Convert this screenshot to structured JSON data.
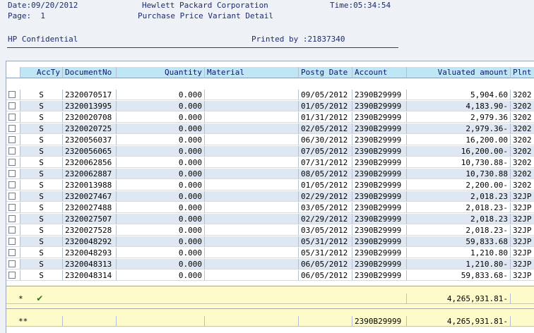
{
  "header": {
    "date": "Date:09/20/2012",
    "page": "Page:  1",
    "company": "Hewlett Packard Corporation",
    "time": "Time:05:34:54",
    "report_title": "Purchase Price Variant Detail",
    "confidential": "HP Confidential",
    "printed_by": "Printed by :21837340"
  },
  "columns": {
    "accty": "AccTy",
    "documentno": "DocumentNo",
    "quantity": "Quantity",
    "material": "Material",
    "postg_date": "Postg Date",
    "account": "Account",
    "valuated_amount": "Valuated amount",
    "plnt": "Plnt"
  },
  "rows": [
    {
      "accty": "S",
      "documentno": "2320070517",
      "quantity": "0.000",
      "material": "",
      "postg_date": "09/05/2012",
      "account": "2390B29999",
      "valuated_amount": "5,904.60",
      "plnt": "3202"
    },
    {
      "accty": "S",
      "documentno": "2320013995",
      "quantity": "0.000",
      "material": "",
      "postg_date": "01/05/2012",
      "account": "2390B29999",
      "valuated_amount": "4,183.90-",
      "plnt": "3202"
    },
    {
      "accty": "S",
      "documentno": "2320020708",
      "quantity": "0.000",
      "material": "",
      "postg_date": "01/31/2012",
      "account": "2390B29999",
      "valuated_amount": "2,979.36",
      "plnt": "3202"
    },
    {
      "accty": "S",
      "documentno": "2320020725",
      "quantity": "0.000",
      "material": "",
      "postg_date": "02/05/2012",
      "account": "2390B29999",
      "valuated_amount": "2,979.36-",
      "plnt": "3202"
    },
    {
      "accty": "S",
      "documentno": "2320056037",
      "quantity": "0.000",
      "material": "",
      "postg_date": "06/30/2012",
      "account": "2390B29999",
      "valuated_amount": "16,200.00",
      "plnt": "3202"
    },
    {
      "accty": "S",
      "documentno": "2320056065",
      "quantity": "0.000",
      "material": "",
      "postg_date": "07/05/2012",
      "account": "2390B29999",
      "valuated_amount": "16,200.00-",
      "plnt": "3202"
    },
    {
      "accty": "S",
      "documentno": "2320062856",
      "quantity": "0.000",
      "material": "",
      "postg_date": "07/31/2012",
      "account": "2390B29999",
      "valuated_amount": "10,730.88-",
      "plnt": "3202"
    },
    {
      "accty": "S",
      "documentno": "2320062887",
      "quantity": "0.000",
      "material": "",
      "postg_date": "08/05/2012",
      "account": "2390B29999",
      "valuated_amount": "10,730.88",
      "plnt": "3202"
    },
    {
      "accty": "S",
      "documentno": "2320013988",
      "quantity": "0.000",
      "material": "",
      "postg_date": "01/05/2012",
      "account": "2390B29999",
      "valuated_amount": "2,200.00-",
      "plnt": "3202"
    },
    {
      "accty": "S",
      "documentno": "2320027467",
      "quantity": "0.000",
      "material": "",
      "postg_date": "02/29/2012",
      "account": "2390B29999",
      "valuated_amount": "2,018.23",
      "plnt": "32JP"
    },
    {
      "accty": "S",
      "documentno": "2320027488",
      "quantity": "0.000",
      "material": "",
      "postg_date": "03/05/2012",
      "account": "2390B29999",
      "valuated_amount": "2,018.23-",
      "plnt": "32JP"
    },
    {
      "accty": "S",
      "documentno": "2320027507",
      "quantity": "0.000",
      "material": "",
      "postg_date": "02/29/2012",
      "account": "2390B29999",
      "valuated_amount": "2,018.23",
      "plnt": "32JP"
    },
    {
      "accty": "S",
      "documentno": "2320027528",
      "quantity": "0.000",
      "material": "",
      "postg_date": "03/05/2012",
      "account": "2390B29999",
      "valuated_amount": "2,018.23-",
      "plnt": "32JP"
    },
    {
      "accty": "S",
      "documentno": "2320048292",
      "quantity": "0.000",
      "material": "",
      "postg_date": "05/31/2012",
      "account": "2390B29999",
      "valuated_amount": "59,833.68",
      "plnt": "32JP"
    },
    {
      "accty": "S",
      "documentno": "2320048293",
      "quantity": "0.000",
      "material": "",
      "postg_date": "05/31/2012",
      "account": "2390B29999",
      "valuated_amount": "1,210.80",
      "plnt": "32JP"
    },
    {
      "accty": "S",
      "documentno": "2320048313",
      "quantity": "0.000",
      "material": "",
      "postg_date": "06/05/2012",
      "account": "2390B29999",
      "valuated_amount": "1,210.80-",
      "plnt": "32JP"
    },
    {
      "accty": "S",
      "documentno": "2320048314",
      "quantity": "0.000",
      "material": "",
      "postg_date": "06/05/2012",
      "account": "2390B29999",
      "valuated_amount": "59,833.68-",
      "plnt": "32JP"
    }
  ],
  "subtotal": {
    "marker": "*",
    "icon": "checkmark-icon",
    "valuated_amount": "4,265,931.81-"
  },
  "total": {
    "marker": "**",
    "account": "2390B29999",
    "valuated_amount": "4,265,931.81-"
  }
}
